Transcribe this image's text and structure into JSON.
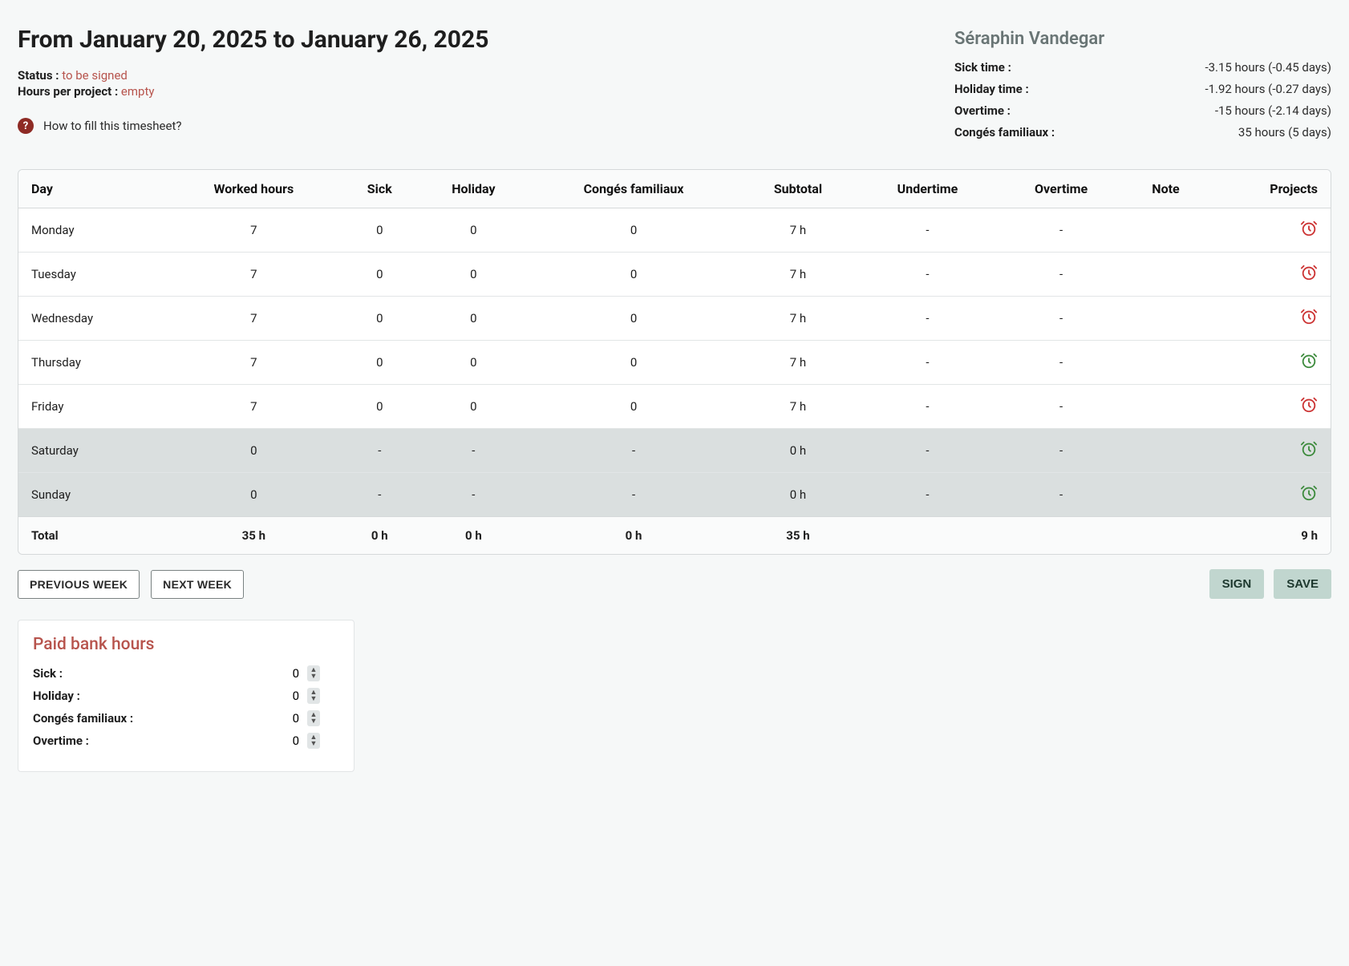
{
  "header": {
    "title": "From January 20, 2025 to January 26, 2025",
    "status_label": "Status :",
    "status_value": "to be signed",
    "hpp_label": "Hours per project :",
    "hpp_value": "empty",
    "help_text": "How to fill this timesheet?"
  },
  "user": {
    "name": "Séraphin Vandegar",
    "summary": [
      {
        "label": "Sick time :",
        "value": "-3.15 hours (-0.45 days)"
      },
      {
        "label": "Holiday time :",
        "value": "-1.92 hours (-0.27 days)"
      },
      {
        "label": "Overtime :",
        "value": "-15 hours (-2.14 days)"
      },
      {
        "label": "Congés familiaux :",
        "value": "35 hours (5 days)"
      }
    ]
  },
  "table": {
    "columns": [
      "Day",
      "Worked hours",
      "Sick",
      "Holiday",
      "Congés familiaux",
      "Subtotal",
      "Undertime",
      "Overtime",
      "Note",
      "Projects"
    ],
    "rows": [
      {
        "day": "Monday",
        "worked": "7",
        "sick": "0",
        "holiday": "0",
        "conges": "0",
        "subtotal": "7 h",
        "undertime": "-",
        "overtime": "-",
        "note": "",
        "clock": "red",
        "weekend": false
      },
      {
        "day": "Tuesday",
        "worked": "7",
        "sick": "0",
        "holiday": "0",
        "conges": "0",
        "subtotal": "7 h",
        "undertime": "-",
        "overtime": "-",
        "note": "",
        "clock": "red",
        "weekend": false
      },
      {
        "day": "Wednesday",
        "worked": "7",
        "sick": "0",
        "holiday": "0",
        "conges": "0",
        "subtotal": "7 h",
        "undertime": "-",
        "overtime": "-",
        "note": "",
        "clock": "red",
        "weekend": false
      },
      {
        "day": "Thursday",
        "worked": "7",
        "sick": "0",
        "holiday": "0",
        "conges": "0",
        "subtotal": "7 h",
        "undertime": "-",
        "overtime": "-",
        "note": "",
        "clock": "green",
        "weekend": false
      },
      {
        "day": "Friday",
        "worked": "7",
        "sick": "0",
        "holiday": "0",
        "conges": "0",
        "subtotal": "7 h",
        "undertime": "-",
        "overtime": "-",
        "note": "",
        "clock": "red",
        "weekend": false
      },
      {
        "day": "Saturday",
        "worked": "0",
        "sick": "-",
        "holiday": "-",
        "conges": "-",
        "subtotal": "0 h",
        "undertime": "-",
        "overtime": "-",
        "note": "",
        "clock": "green",
        "weekend": true
      },
      {
        "day": "Sunday",
        "worked": "0",
        "sick": "-",
        "holiday": "-",
        "conges": "-",
        "subtotal": "0 h",
        "undertime": "-",
        "overtime": "-",
        "note": "",
        "clock": "green",
        "weekend": true
      }
    ],
    "totals": {
      "label": "Total",
      "worked": "35 h",
      "sick": "0 h",
      "holiday": "0 h",
      "conges": "0 h",
      "subtotal": "35 h",
      "projects": "9 h"
    }
  },
  "nav": {
    "prev": "PREVIOUS WEEK",
    "next": "NEXT WEEK",
    "sign": "SIGN",
    "save": "SAVE"
  },
  "bank": {
    "title": "Paid bank hours",
    "rows": [
      {
        "label": "Sick :",
        "value": "0"
      },
      {
        "label": "Holiday :",
        "value": "0"
      },
      {
        "label": "Congés familiaux :",
        "value": "0"
      },
      {
        "label": "Overtime :",
        "value": "0"
      }
    ]
  }
}
